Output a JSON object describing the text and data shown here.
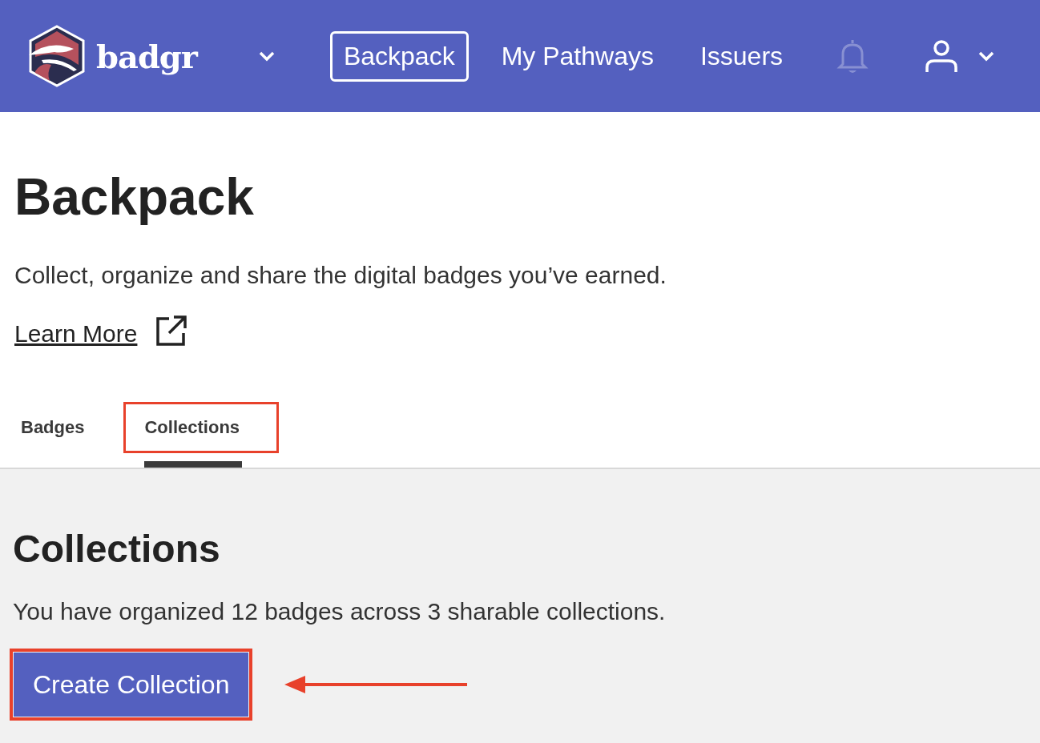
{
  "header": {
    "brand": "badgr",
    "nav": [
      {
        "label": "Backpack",
        "selected": true
      },
      {
        "label": "My Pathways",
        "selected": false
      },
      {
        "label": "Issuers",
        "selected": false
      }
    ],
    "notifications_disabled": true
  },
  "page": {
    "title": "Backpack",
    "description": "Collect, organize and share the digital badges you’ve earned.",
    "learn_more": "Learn More"
  },
  "tabs": [
    {
      "label": "Badges",
      "selected": false,
      "highlighted": false
    },
    {
      "label": "Collections",
      "selected": true,
      "highlighted": true
    }
  ],
  "section": {
    "title": "Collections",
    "summary": "You have organized 12 badges across 3 sharable collections.",
    "button": {
      "label": "Create Collection",
      "highlighted": true,
      "pointed_at": true
    }
  }
}
